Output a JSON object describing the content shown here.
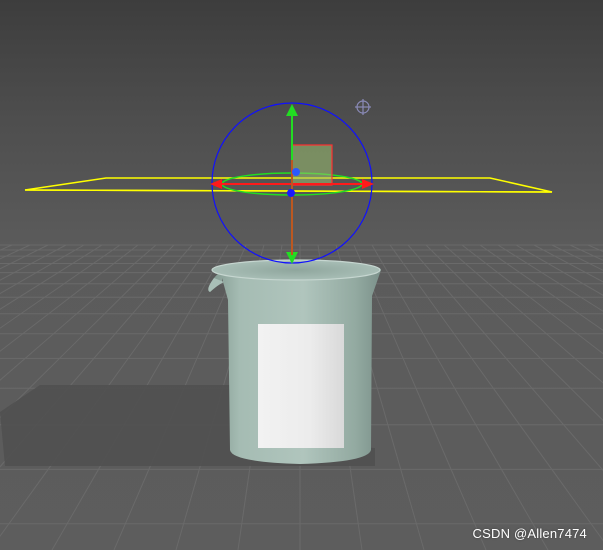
{
  "viewport": {
    "background": "#4e4e4e",
    "grid_color": "#6a6a6a",
    "plane_color": "#ffff00",
    "gizmo": {
      "x_axis_color": "#ff0000",
      "y_axis_color": "#00cc00",
      "z_axis_color": "#1a1aff",
      "rotate_ring_color": "#0000ff",
      "scale_box_color": "#a0c080"
    },
    "pivot_icon": "crosshair-pivot-icon"
  },
  "beaker": {
    "glass_color": "#9fb7ae",
    "label_color": "#e9e9e9"
  },
  "watermark": "CSDN @Allen7474"
}
